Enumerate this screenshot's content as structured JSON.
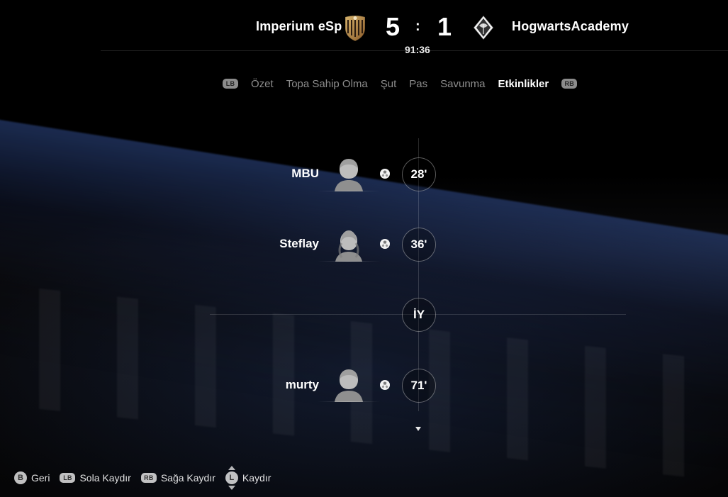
{
  "header": {
    "home_team": "Imperium eSp",
    "away_team": "HogwartsAcademy",
    "home_score": "5",
    "away_score": "1",
    "score_separator": ":",
    "match_clock": "91:36",
    "home_crest_icon": "imperium-crest-icon",
    "away_crest_icon": "gladbach-crest-icon"
  },
  "tabs": {
    "left_bumper": "LB",
    "right_bumper": "RB",
    "items": [
      {
        "label": "Özet",
        "active": false
      },
      {
        "label": "Topa Sahip Olma",
        "active": false
      },
      {
        "label": "Şut",
        "active": false
      },
      {
        "label": "Pas",
        "active": false
      },
      {
        "label": "Savunma",
        "active": false
      },
      {
        "label": "Etkinlikler",
        "active": true
      }
    ]
  },
  "timeline": {
    "events": [
      {
        "player": "MBU",
        "minute": "28'",
        "event_icon": "goal-ball-icon"
      },
      {
        "player": "Steflay",
        "minute": "36'",
        "event_icon": "goal-ball-icon"
      },
      {
        "player": "murty",
        "minute": "71'",
        "event_icon": "goal-ball-icon"
      }
    ],
    "half_time_label": "İY",
    "more_indicator_icon": "scroll-down-arrow-icon"
  },
  "controls": {
    "items": [
      {
        "button": "B",
        "label": "Geri",
        "icon": "b-button-icon"
      },
      {
        "button": "LB",
        "label": "Sola Kaydır",
        "icon": "lb-button-icon"
      },
      {
        "button": "RB",
        "label": "Sağa Kaydır",
        "icon": "rb-button-icon"
      },
      {
        "button": "L",
        "label": "Kaydır",
        "icon": "left-stick-icon"
      }
    ]
  },
  "colors": {
    "background": "#0b0b0c",
    "text": "#ffffff",
    "muted_text": "#8c8c8c",
    "badge_border": "#6b6b6b",
    "accent_blue": "#3b5caa"
  }
}
